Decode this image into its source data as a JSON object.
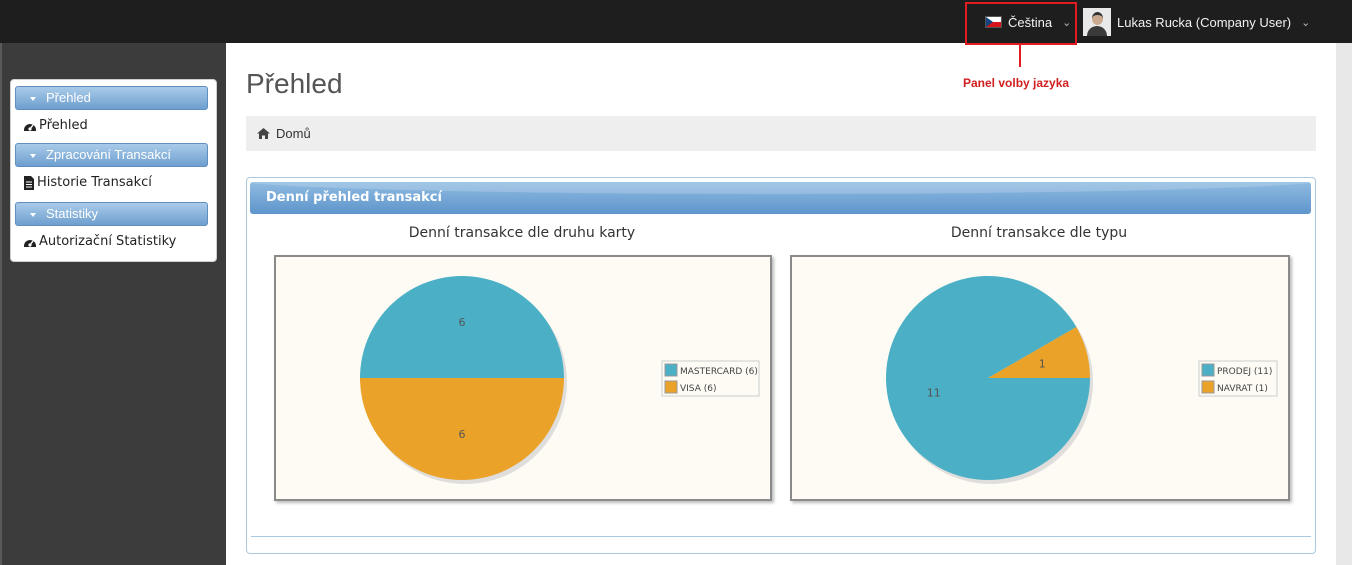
{
  "header": {
    "language": "Čeština",
    "user": "Lukas Rucka (Company User)",
    "annotation": "Panel volby jazyka"
  },
  "sidebar": {
    "sections": [
      {
        "label": "Přehled",
        "items": [
          {
            "label": "Přehled",
            "icon": "dashboard-icon"
          }
        ]
      },
      {
        "label": "Zpracování Transakcí",
        "items": [
          {
            "label": "Historie Transakcí",
            "icon": "file-icon"
          }
        ]
      },
      {
        "label": "Statistiky",
        "items": [
          {
            "label": "Autorizační Statistiky",
            "icon": "dashboard-icon"
          }
        ]
      }
    ]
  },
  "page": {
    "title": "Přehled",
    "breadcrumb": "Domů"
  },
  "widget": {
    "title": "Denní přehled transakcí"
  },
  "colors": {
    "blue": "#4bb0c6",
    "orange": "#eaa229"
  },
  "chart_data": [
    {
      "type": "pie",
      "title": "Denní transakce dle druhu karty",
      "categories": [
        "MASTERCARD",
        "VISA"
      ],
      "values": [
        6,
        6
      ],
      "legend": [
        "MASTERCARD (6)",
        "VISA (6)"
      ],
      "legend_position": "right"
    },
    {
      "type": "pie",
      "title": "Denní transakce dle typu",
      "categories": [
        "PRODEJ",
        "NAVRAT"
      ],
      "values": [
        11,
        1
      ],
      "legend": [
        "PRODEJ (11)",
        "NAVRAT (1)"
      ],
      "legend_position": "right"
    }
  ]
}
